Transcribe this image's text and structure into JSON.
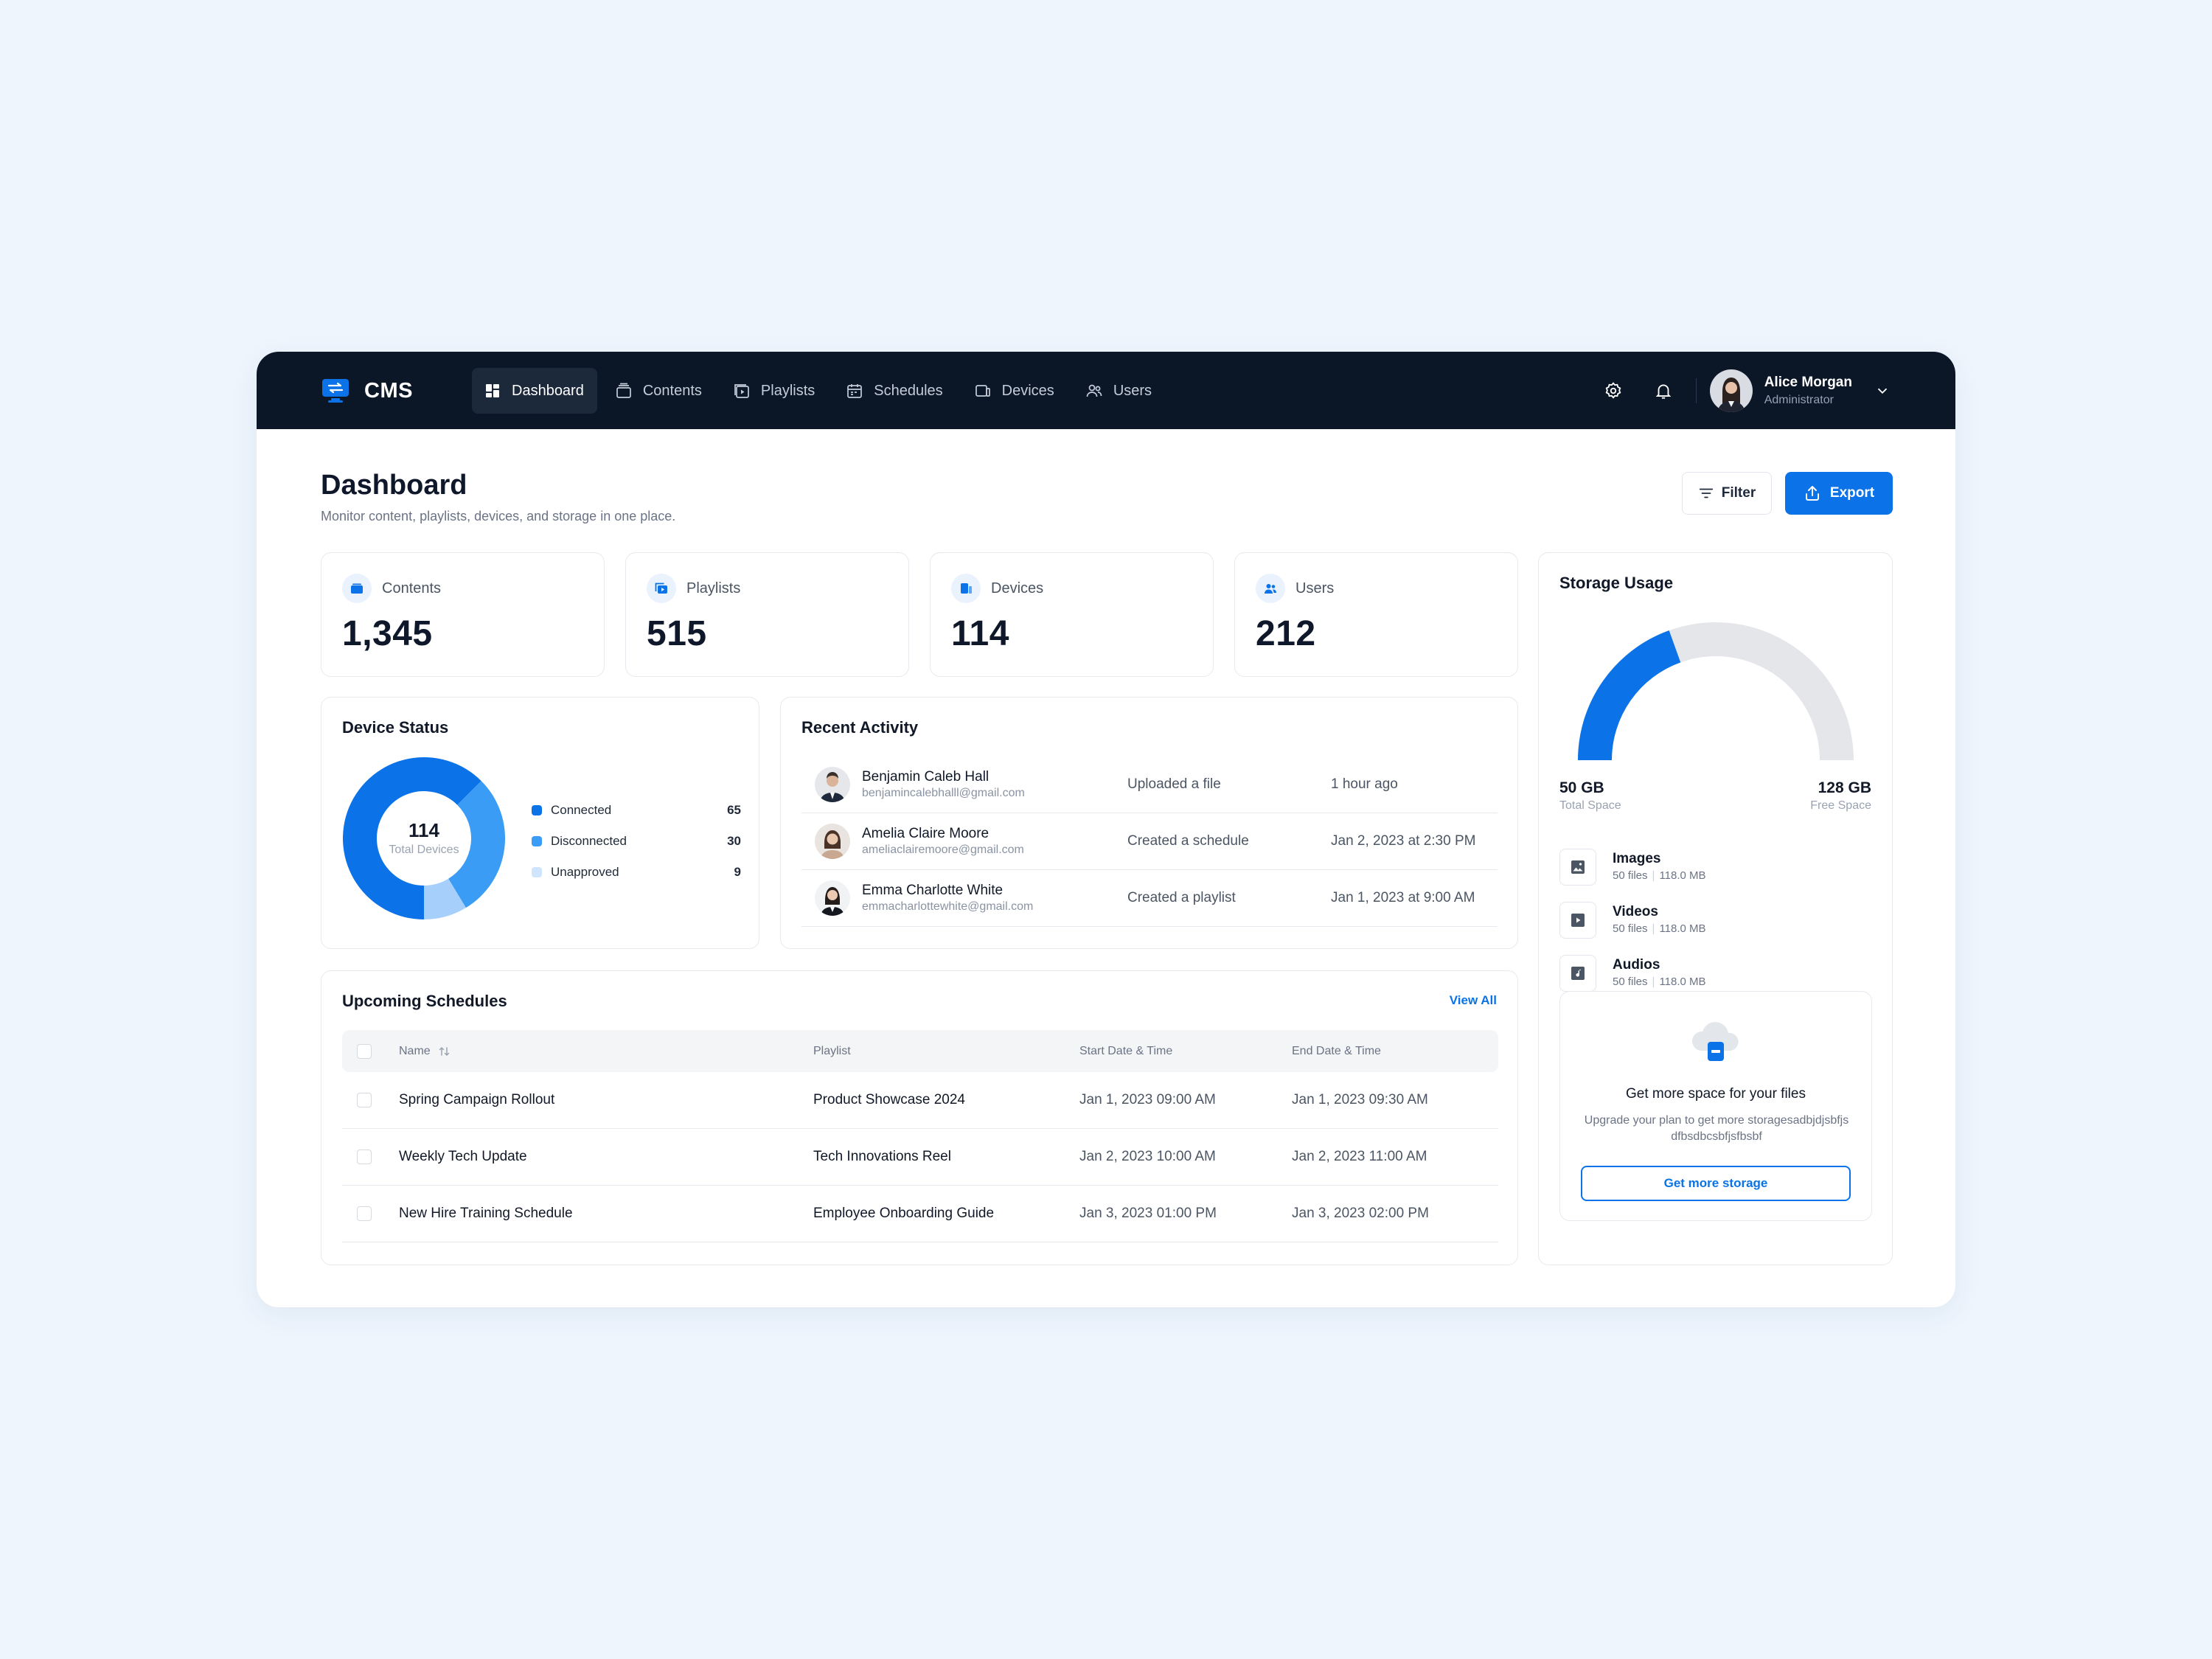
{
  "colors": {
    "accent": "#0b72e7",
    "topbar": "#0b1727",
    "connected": "#0b72e7",
    "disconnected": "#3b9cf5",
    "unapproved": "#a6d0fb",
    "gauge_free": "#e4e6ea"
  },
  "app": {
    "name": "CMS",
    "logo_icon": "monitor-icon"
  },
  "nav": {
    "items": [
      {
        "label": "Dashboard",
        "icon": "dashboard-icon",
        "active": true
      },
      {
        "label": "Contents",
        "icon": "contents-icon"
      },
      {
        "label": "Playlists",
        "icon": "playlist-icon"
      },
      {
        "label": "Schedules",
        "icon": "calendar-icon"
      },
      {
        "label": "Devices",
        "icon": "devices-icon"
      },
      {
        "label": "Users",
        "icon": "users-icon"
      }
    ]
  },
  "user": {
    "name": "Alice Morgan",
    "role": "Administrator"
  },
  "header": {
    "title": "Dashboard",
    "subtitle": "Monitor content, playlists, devices, and storage in one place.",
    "filter_label": "Filter",
    "export_label": "Export"
  },
  "stats": [
    {
      "label": "Contents",
      "value": "1,345",
      "icon": "folder-icon"
    },
    {
      "label": "Playlists",
      "value": "515",
      "icon": "playlist-icon"
    },
    {
      "label": "Devices",
      "value": "114",
      "icon": "devices-icon"
    },
    {
      "label": "Users",
      "value": "212",
      "icon": "users-icon"
    }
  ],
  "device_status": {
    "title": "Device Status",
    "total": "114",
    "total_label": "Total Devices",
    "items": [
      {
        "label": "Connected",
        "value": 65,
        "color": "#0b72e7"
      },
      {
        "label": "Disconnected",
        "value": 30,
        "color": "#3b9cf5"
      },
      {
        "label": "Unapproved",
        "value": 9,
        "color": "#a6d0fb"
      }
    ]
  },
  "activity": {
    "title": "Recent Activity",
    "rows": [
      {
        "name": "Benjamin Caleb Hall",
        "email": "benjamincalebhalll@gmail.com",
        "action": "Uploaded a file",
        "time": "1 hour ago"
      },
      {
        "name": "Amelia Claire Moore",
        "email": "ameliaclairemoore@gmail.com",
        "action": "Created a schedule",
        "time": "Jan 2, 2023 at 2:30 PM"
      },
      {
        "name": "Emma Charlotte White",
        "email": "emmacharlottewhite@gmail.com",
        "action": "Created a playlist",
        "time": "Jan 1, 2023 at 9:00 AM"
      }
    ]
  },
  "schedules": {
    "title": "Upcoming Schedules",
    "view_all": "View All",
    "columns": {
      "name": "Name",
      "playlist": "Playlist",
      "start": "Start Date & Time",
      "end": "End Date & Time"
    },
    "rows": [
      {
        "name": "Spring Campaign Rollout",
        "playlist": "Product Showcase 2024",
        "start": "Jan 1, 2023  09:00 AM",
        "end": "Jan 1, 2023  09:30 AM"
      },
      {
        "name": "Weekly Tech Update",
        "playlist": "Tech Innovations Reel",
        "start": "Jan 2, 2023  10:00 AM",
        "end": "Jan 2, 2023  11:00 AM"
      },
      {
        "name": "New Hire Training Schedule",
        "playlist": "Employee Onboarding Guide",
        "start": "Jan 3, 2023  01:00 PM",
        "end": "Jan 3, 2023  02:00 PM"
      }
    ]
  },
  "storage": {
    "title": "Storage Usage",
    "used_fraction": 0.39,
    "total_value": "50 GB",
    "total_label": "Total Space",
    "free_value": "128 GB",
    "free_label": "Free Space",
    "types": [
      {
        "name": "Images",
        "files": "50 files",
        "size": "118.0 MB",
        "icon": "image-icon"
      },
      {
        "name": "Videos",
        "files": "50 files",
        "size": "118.0 MB",
        "icon": "video-icon"
      },
      {
        "name": "Audios",
        "files": "50 files",
        "size": "118.0 MB",
        "icon": "audio-icon"
      }
    ],
    "upsell": {
      "title": "Get more space for your files",
      "subtitle": "Upgrade your plan to get more storagesadbjdjsbfjsdfbsdbcsbfjsfbsbf",
      "button": "Get more storage"
    }
  }
}
